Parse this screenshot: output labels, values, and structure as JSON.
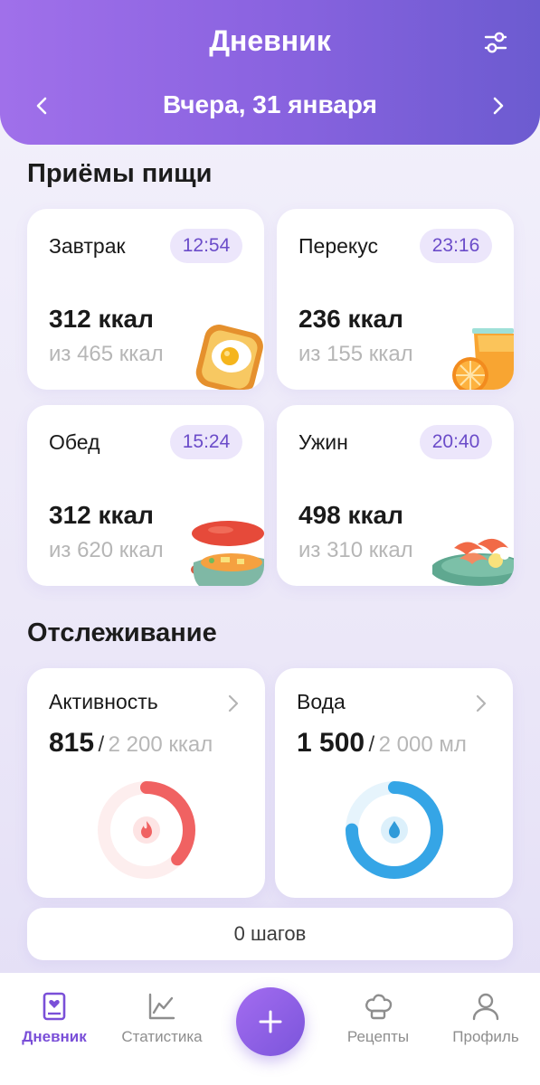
{
  "header": {
    "title": "Дневник",
    "date": "Вчера,  31 января"
  },
  "meals_section": {
    "title": "Приёмы пищи",
    "items": [
      {
        "name": "Завтрак",
        "time": "12:54",
        "kcal": "312 ккал",
        "of": "из 465 ккал",
        "icon": "toast-egg-icon"
      },
      {
        "name": "Перекус",
        "time": "23:16",
        "kcal": "236 ккал",
        "of": "из 155 ккал",
        "icon": "orange-juice-icon"
      },
      {
        "name": "Обед",
        "time": "15:24",
        "kcal": "312 ккал",
        "of": "из 620 ккал",
        "icon": "soup-pot-icon"
      },
      {
        "name": "Ужин",
        "time": "20:40",
        "kcal": "498 ккал",
        "of": "из 310 ккал",
        "icon": "shrimp-plate-icon"
      }
    ]
  },
  "tracking": {
    "title": "Отслеживание",
    "activity": {
      "name": "Активность",
      "current": "815",
      "sep": "/",
      "goal": "2 200 ккал",
      "progress": 0.37,
      "color": "#f06262"
    },
    "water": {
      "name": "Вода",
      "current": "1 500",
      "sep": "/",
      "goal": "2 000 мл",
      "progress": 0.75,
      "color": "#35a5e6"
    },
    "steps": "0 шагов"
  },
  "tabbar": {
    "diary": "Дневник",
    "stats": "Статистика",
    "recipes": "Рецепты",
    "profile": "Профиль",
    "accent": "#7a4fd8"
  }
}
